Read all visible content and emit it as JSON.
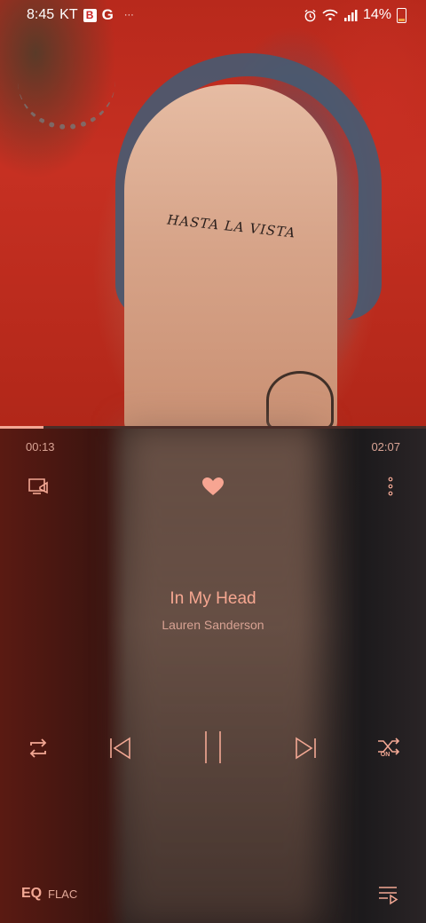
{
  "status_bar": {
    "time": "8:45",
    "carrier": "KT",
    "app_badges": [
      "B",
      "G"
    ],
    "more": "···",
    "battery_percent": "14%",
    "icons": [
      "alarm-icon",
      "wifi-icon",
      "signal-icon",
      "battery-icon"
    ]
  },
  "album_art": {
    "tattoo_text": "HASTA LA VISTA"
  },
  "player": {
    "elapsed": "00:13",
    "duration": "02:07",
    "progress_fraction": 0.102,
    "favorite": true,
    "track_title": "In My Head",
    "artist": "Lauren Sanderson",
    "controls": [
      "repeat-icon",
      "previous-icon",
      "pause-icon",
      "next-icon",
      "shuffle-icon"
    ],
    "shuffle_state_label": "ON",
    "eq_label": "EQ",
    "format_label": "FLAC"
  },
  "colors": {
    "accent": "#f3a894",
    "status_text": "#ffffff"
  }
}
